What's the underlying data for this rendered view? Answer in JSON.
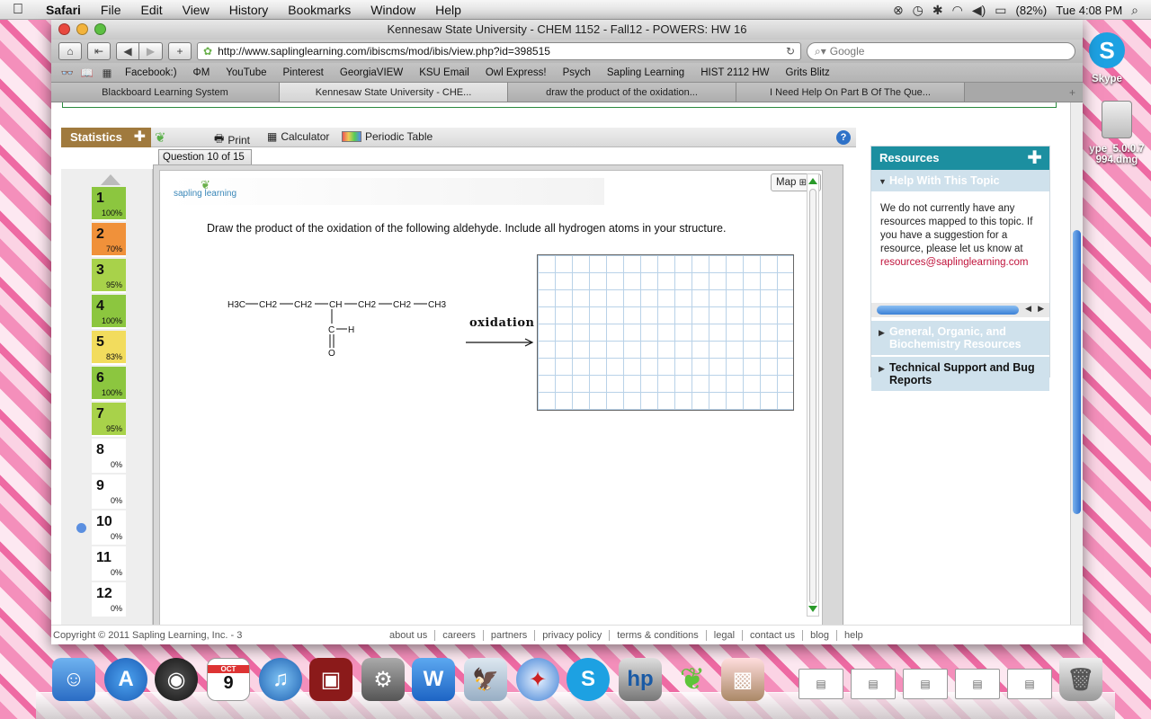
{
  "menubar": {
    "app": "Safari",
    "items": [
      "File",
      "Edit",
      "View",
      "History",
      "Bookmarks",
      "Window",
      "Help"
    ],
    "battery": "(82%)",
    "clock": "Tue 4:08 PM"
  },
  "window": {
    "title": "Kennesaw State University - CHEM 1152 - Fall12 - POWERS: HW 16",
    "url": "http://www.saplinglearning.com/ibiscms/mod/ibis/view.php?id=398515",
    "search_placeholder": "Google"
  },
  "bookmarks": [
    "Facebook:)",
    "ΦM",
    "YouTube",
    "Pinterest",
    "GeorgiaVIEW",
    "KSU Email",
    "Owl Express!",
    "Psych",
    "Sapling Learning",
    "HIST 2112 HW",
    "Grits Blitz"
  ],
  "tabs": [
    {
      "label": "Blackboard Learning System"
    },
    {
      "label": "Kennesaw State University - CHE..."
    },
    {
      "label": "draw the product of the oxidation..."
    },
    {
      "label": "I Need Help On Part B Of The Que..."
    }
  ],
  "toolbar": {
    "statistics": "Statistics",
    "print": "Print",
    "calculator": "Calculator",
    "periodic_table": "Periodic Table",
    "help": "?"
  },
  "question": {
    "tab_label": "Question 10 of 15",
    "map_label": "Map",
    "logo_text": "sapling learning",
    "prompt": "Draw the product of the oxidation of the following aldehyde. Include all hydrogen atoms in your structure.",
    "reaction_label": "oxidation",
    "molecule": {
      "chain": [
        "H3C",
        "CH2",
        "CH2",
        "CH",
        "CH2",
        "CH2",
        "CH3"
      ],
      "carbonyl_c": "C",
      "carbonyl_h": "H",
      "carbonyl_o": "O"
    }
  },
  "questions": [
    {
      "num": "1",
      "pct": "100%",
      "color": "#8cc63f"
    },
    {
      "num": "2",
      "pct": "70%",
      "color": "#f0913a"
    },
    {
      "num": "3",
      "pct": "95%",
      "color": "#a8d24a"
    },
    {
      "num": "4",
      "pct": "100%",
      "color": "#8cc63f"
    },
    {
      "num": "5",
      "pct": "83%",
      "color": "#f2dc5d"
    },
    {
      "num": "6",
      "pct": "100%",
      "color": "#8cc63f"
    },
    {
      "num": "7",
      "pct": "95%",
      "color": "#a8d24a"
    },
    {
      "num": "8",
      "pct": "0%",
      "color": "#ffffff"
    },
    {
      "num": "9",
      "pct": "0%",
      "color": "#ffffff"
    },
    {
      "num": "10",
      "pct": "0%",
      "color": "#ffffff"
    },
    {
      "num": "11",
      "pct": "0%",
      "color": "#ffffff"
    },
    {
      "num": "12",
      "pct": "0%",
      "color": "#ffffff"
    }
  ],
  "resources": {
    "title": "Resources",
    "help_topic": "Help With This Topic",
    "body": "We do not currently have any resources mapped to this topic. If you have a suggestion for a resource, please let us know at",
    "email": "resources@saplinglearning.com",
    "section2": "General, Organic, and Biochemistry Resources",
    "section3": "Technical Support and Bug Reports"
  },
  "footer": {
    "copyright": "Copyright © 2011 Sapling Learning, Inc. - 3",
    "links": [
      "about us",
      "careers",
      "partners",
      "privacy policy",
      "terms & conditions",
      "legal",
      "contact us",
      "blog",
      "help"
    ]
  },
  "desktop": {
    "skype_label": "Skype",
    "dmg_label_1": "ype_5.0.0.7",
    "dmg_label_2": "994.dmg"
  },
  "dock": {
    "calendar_month": "OCT",
    "calendar_day": "9"
  }
}
